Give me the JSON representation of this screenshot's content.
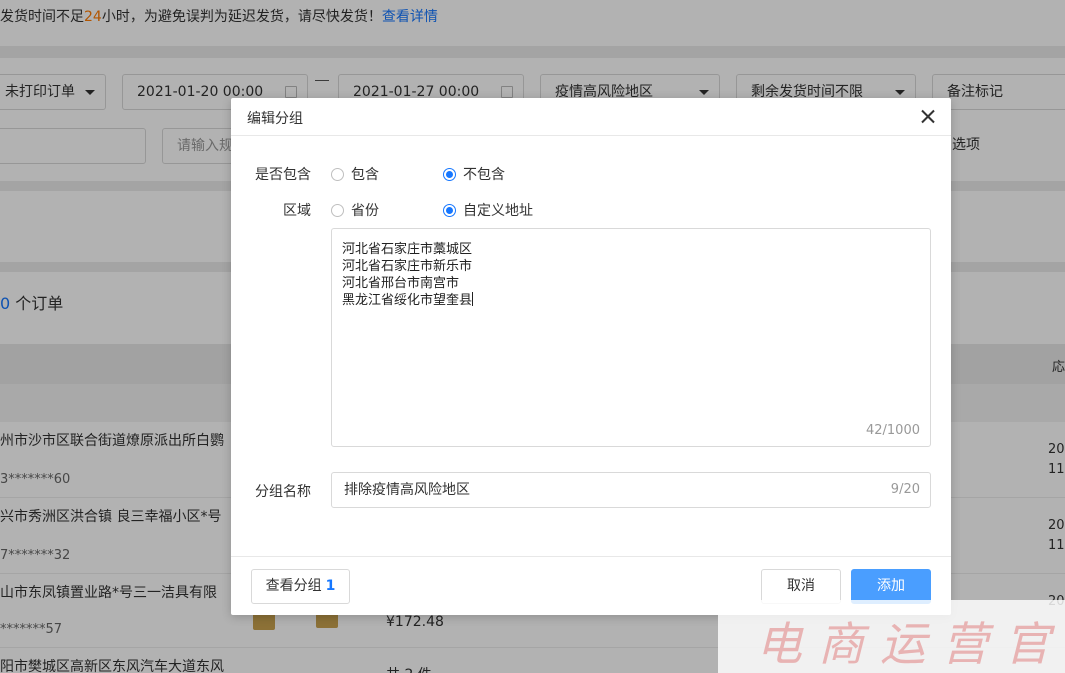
{
  "background": {
    "notice": {
      "prefix": "发货时间不足",
      "hours": "24",
      "suffix": "小时，为避免误判为延迟发货，请尽快发货！",
      "link": "查看详情"
    },
    "filters": {
      "print_status": "未打印订单",
      "start_date": "2021-01-20 00:00",
      "end_date": "2021-01-27 00:00",
      "region": "疫情高风险地区",
      "remaining_time": "剩余发货时间不限",
      "remark": "备注标记",
      "spec_placeholder": "请输入规",
      "options_label": "选项"
    },
    "order_count": {
      "num": "0",
      "label": "个订单"
    },
    "table_header_right": "応",
    "rows": [
      {
        "address": "州市沙市区联合街道燎原派出所白鹦",
        "phone": "3*******60",
        "date1": "20",
        "date2": "11"
      },
      {
        "address": "兴市秀洲区洪合镇 良三幸福小区*号",
        "phone": "7*******32",
        "date1": "20",
        "date2": "11"
      },
      {
        "address": "山市东凤镇置业路*号三一洁具有限",
        "phone": "*******57",
        "price": "¥172.48",
        "date1": "20"
      },
      {
        "address": "阳市樊城区高新区东风汽车大道东风",
        "phone": "",
        "total": "共 2 件"
      }
    ]
  },
  "modal": {
    "title": "编辑分组",
    "include": {
      "label": "是否包含",
      "options": [
        "包含",
        "不包含"
      ],
      "selected": "不包含"
    },
    "region": {
      "label": "区域",
      "options": [
        "省份",
        "自定义地址"
      ],
      "selected": "自定义地址"
    },
    "addresses": [
      "河北省石家庄市藁城区",
      "河北省石家庄市新乐市",
      "河北省邢台市南宫市",
      "黑龙江省绥化市望奎县"
    ],
    "address_counter": "42/1000",
    "group_name": {
      "label": "分组名称",
      "value": "排除疫情高风险地区",
      "counter": "9/20"
    },
    "footer": {
      "view_groups": "查看分组",
      "view_groups_count": "1",
      "cancel": "取消",
      "add": "添加"
    }
  },
  "watermark": "电商运营官",
  "colors": {
    "primary": "#4a9eff",
    "link": "#1677ff",
    "highlight": "#ff7a00"
  }
}
